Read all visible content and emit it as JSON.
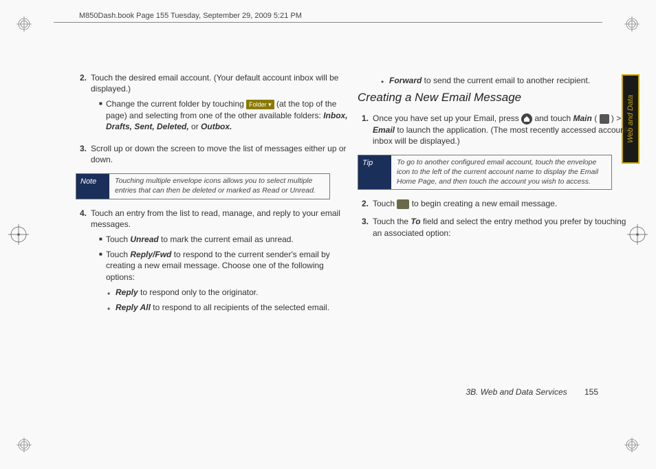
{
  "header": {
    "book_meta": "M850Dash.book  Page 155  Tuesday, September 29, 2009  5:21 PM"
  },
  "side_tab": "Web and Data",
  "footer": {
    "section": "3B. Web and Data Services",
    "page": "155"
  },
  "left": {
    "s2_num": "2.",
    "s2_body_a": "Touch the desired email account. (Your default account inbox will be displayed.)",
    "s2_sub_a": "Change the current folder by touching ",
    "folder_label": "Folder ▾",
    "s2_sub_b": " (at the top of the page) and selecting from one of the other available folders: ",
    "s2_folders": "Inbox, Drafts, Sent, Deleted, ",
    "s2_or": "or ",
    "s2_outbox": "Outbox.",
    "s3_num": "3.",
    "s3_body": "Scroll up or down the screen to move the list of messages either up or down.",
    "note_label": "Note",
    "note_body": "Touching multiple envelope icons allows you to select multiple entries that can then be deleted or marked as Read or Unread.",
    "s4_num": "4.",
    "s4_body": "Touch an entry from the list to read, manage, and reply to your email messages.",
    "s4_sub1_a": "Touch ",
    "s4_sub1_b": "Unread",
    "s4_sub1_c": " to mark the current email as unread.",
    "s4_sub2_a": "Touch ",
    "s4_sub2_b": "Reply/Fwd",
    "s4_sub2_c": " to respond to the current sender's email by creating a new email message. Choose one of the following options:",
    "b1_a": "Reply",
    "b1_b": " to respond only to the originator.",
    "b2_a": "Reply All",
    "b2_b": " to respond to all recipients of the selected email."
  },
  "right": {
    "b3_a": "Forward",
    "b3_b": " to send the current email to another recipient.",
    "heading": "Creating a New Email Message",
    "r1_num": "1.",
    "r1_a": "Once you have set up your Email, press ",
    "r1_b": " and touch ",
    "r1_main": "Main",
    "r1_c": " ( ",
    "r1_d": " ) > ",
    "r1_email": "Email",
    "r1_e": "  to launch the application. (The most recently accessed account inbox will be displayed.)",
    "tip_label": "Tip",
    "tip_body": "To go to another configured email account, touch the envelope icon to the left of the current account name to display the Email Home Page, and then touch the account you wish to access.",
    "r2_num": "2.",
    "r2_a": "Touch  ",
    "r2_b": "  to begin creating a new email message.",
    "r3_num": "3.",
    "r3_a": "Touch the ",
    "r3_to": "To",
    "r3_b": " field and select the entry method you prefer by touching an associated option:"
  }
}
